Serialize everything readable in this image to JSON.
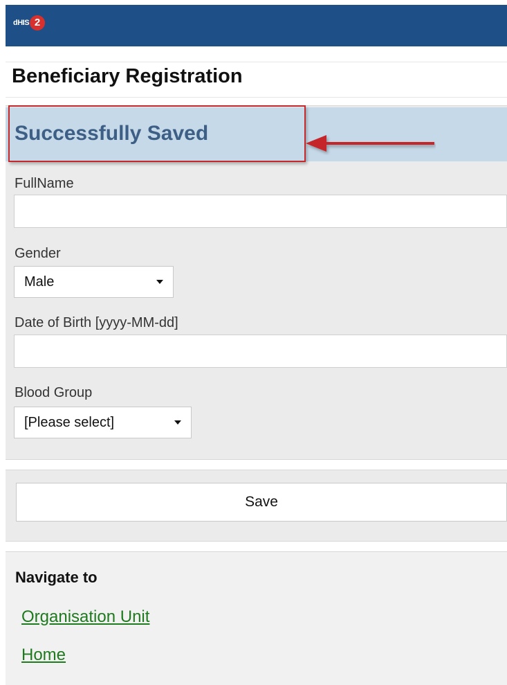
{
  "app": {
    "logo_text": "dHIS",
    "logo_badge": "2"
  },
  "page": {
    "title": "Beneficiary Registration"
  },
  "message": {
    "text": "Successfully Saved",
    "highlight_color": "#c4282b"
  },
  "form": {
    "fullname": {
      "label": "FullName",
      "value": ""
    },
    "gender": {
      "label": "Gender",
      "selected": "Male"
    },
    "dob": {
      "label": "Date of Birth [yyyy-MM-dd]",
      "value": ""
    },
    "blood_group": {
      "label": "Blood Group",
      "selected": "[Please select]"
    }
  },
  "actions": {
    "save_label": "Save"
  },
  "navigation": {
    "title": "Navigate to",
    "links": [
      {
        "label": "Organisation Unit"
      },
      {
        "label": "Home"
      }
    ]
  },
  "colors": {
    "topbar": "#1e4f86",
    "message_bar": "#c6d9e8",
    "message_text": "#3d5f86",
    "link": "#1f7a1f"
  }
}
